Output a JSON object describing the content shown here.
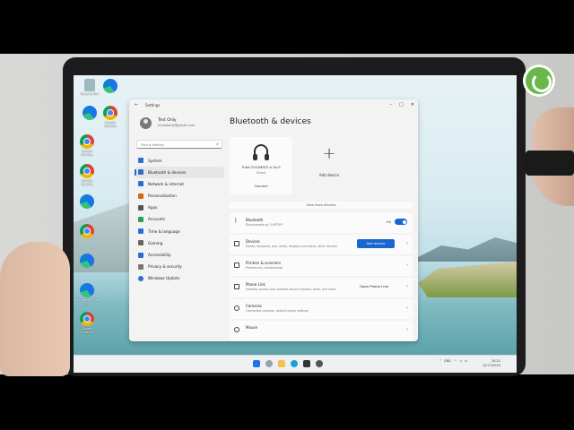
{
  "desktop": {
    "icons": [
      {
        "label": "Recycle Bin",
        "icon": "recycle-bin-icon"
      },
      {
        "label": "",
        "icon": "edge-icon"
      },
      {
        "label": "",
        "icon": "edge-icon"
      },
      {
        "label": "Google Chrome",
        "icon": "chrome-icon"
      },
      {
        "label": "Google Chrome",
        "icon": "chrome-icon"
      },
      {
        "label": "Google Chrome",
        "icon": "chrome-icon"
      },
      {
        "label": "",
        "icon": "edge-icon"
      },
      {
        "label": "",
        "icon": "chrome-icon"
      },
      {
        "label": "",
        "icon": "edge-icon"
      },
      {
        "label": "",
        "icon": "chrome-icon"
      },
      {
        "label": "Microsoft Edge - C...",
        "icon": "edge-icon"
      },
      {
        "label": "Google Chrome",
        "icon": "chrome-icon"
      }
    ]
  },
  "window": {
    "title": "Settings",
    "controls": {
      "minimize": "–",
      "maximize": "□",
      "close": "✕"
    }
  },
  "profile": {
    "name": "Test Only",
    "email": "hctestonly@gmail.com"
  },
  "search": {
    "placeholder": "Find a setting"
  },
  "nav": [
    {
      "label": "System",
      "color": "#2b6fd1",
      "active": false
    },
    {
      "label": "Bluetooth & devices",
      "color": "#2b6fd1",
      "active": true
    },
    {
      "label": "Network & internet",
      "color": "#2b6fd1",
      "active": false
    },
    {
      "label": "Personalization",
      "color": "#d2691e",
      "active": false
    },
    {
      "label": "Apps",
      "color": "#555555",
      "active": false
    },
    {
      "label": "Accounts",
      "color": "#2f9e5a",
      "active": false
    },
    {
      "label": "Time & language",
      "color": "#2b6fd1",
      "active": false
    },
    {
      "label": "Gaming",
      "color": "#666666",
      "active": false
    },
    {
      "label": "Accessibility",
      "color": "#2b6fd1",
      "active": false
    },
    {
      "label": "Privacy & security",
      "color": "#777777",
      "active": false
    },
    {
      "label": "Windows Update",
      "color": "#2b6fd1",
      "active": false
    }
  ],
  "main": {
    "title": "Bluetooth & devices",
    "device": {
      "name": "Tribit SOLOMATE vl Se-0",
      "status": "Paired",
      "action": "Connect"
    },
    "add_device": {
      "label": "Add device"
    },
    "view_more": "View more devices",
    "rows": [
      {
        "title": "Bluetooth",
        "desc": "Discoverable as \"LAPTOP\"",
        "state": "On",
        "type": "toggle"
      },
      {
        "title": "Devices",
        "desc": "Mouse, keyboard, pen, audio, displays and docks, other devices",
        "button": "Add device",
        "type": "button"
      },
      {
        "title": "Printers & scanners",
        "desc": "Preferences, troubleshoot",
        "type": "chevron"
      },
      {
        "title": "Phone Link",
        "desc": "Instantly access your Android device's photos, texts, and more",
        "button": "Open Phone Link",
        "type": "link"
      },
      {
        "title": "Cameras",
        "desc": "Connected cameras, default image settings",
        "type": "chevron"
      },
      {
        "title": "Mouse",
        "desc": "",
        "type": "chevron"
      }
    ]
  },
  "taskbar": {
    "time": "10:21",
    "date": "12/17/2023",
    "lang": "ENG",
    "apps": [
      "start-icon",
      "search-icon",
      "explorer-icon",
      "edge-icon",
      "store-icon",
      "settings-icon"
    ]
  },
  "colors": {
    "accent": "#1a66d0",
    "badge": "#6ab84a"
  }
}
